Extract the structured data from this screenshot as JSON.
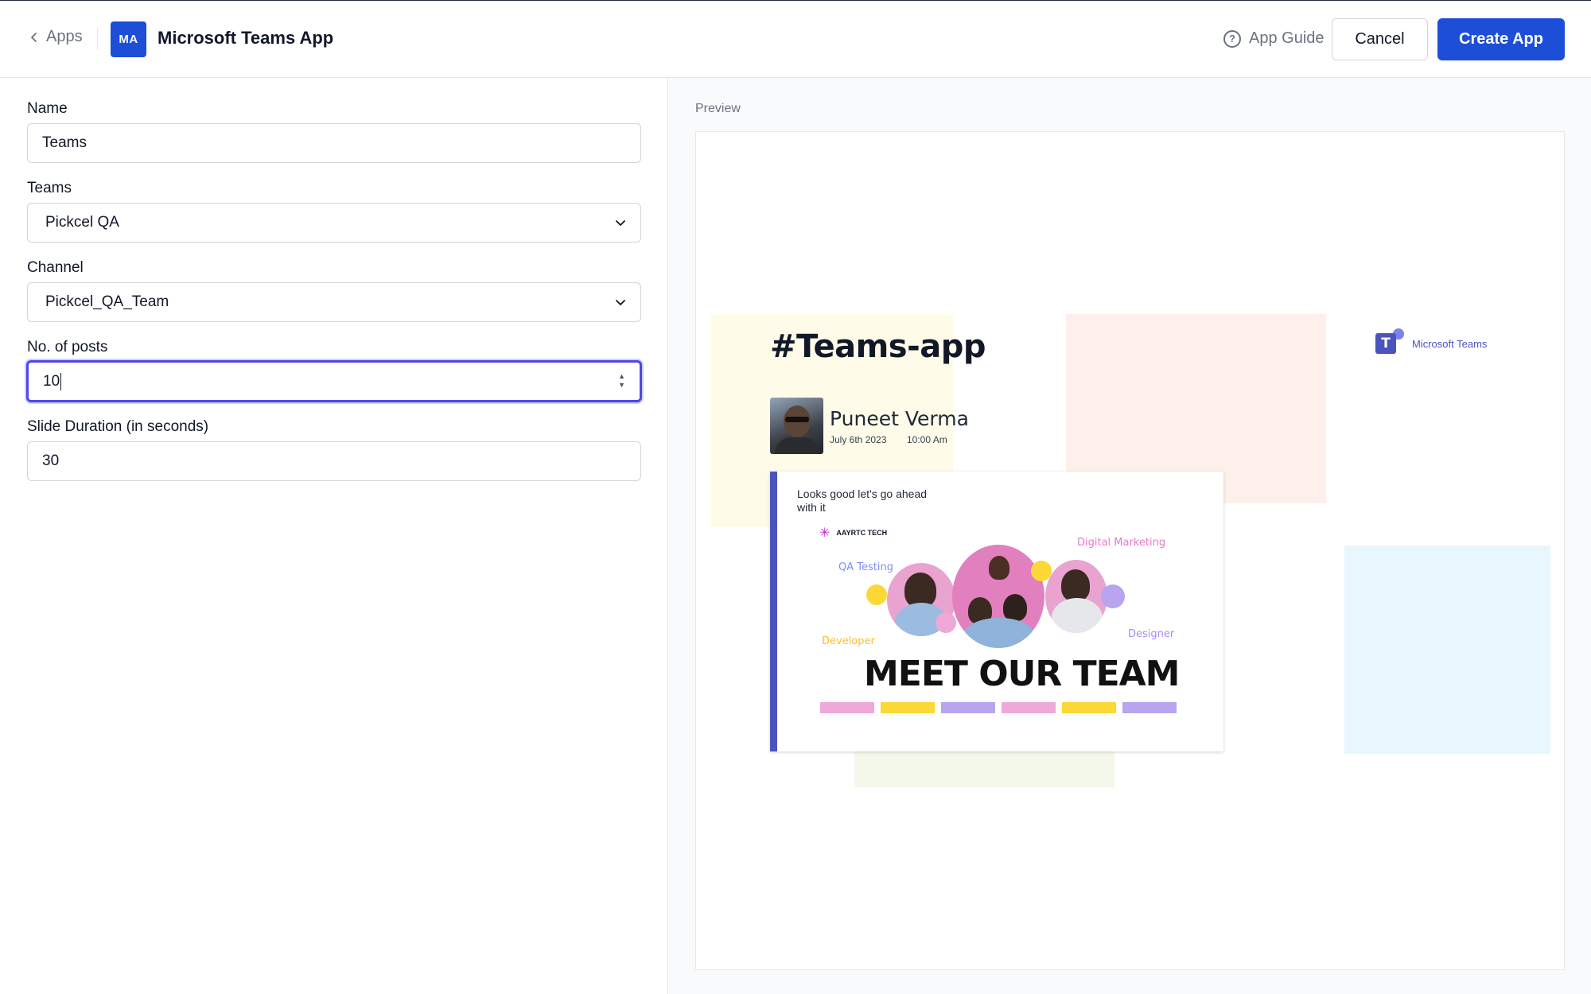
{
  "header": {
    "back_label": "Apps",
    "avatar_initials": "MA",
    "title": "Microsoft Teams App",
    "guide_label": "App Guide",
    "cancel_label": "Cancel",
    "create_label": "Create App"
  },
  "form": {
    "name": {
      "label": "Name",
      "value": "Teams"
    },
    "teams": {
      "label": "Teams",
      "value": "Pickcel QA"
    },
    "channel": {
      "label": "Channel",
      "value": "Pickcel_QA_Team"
    },
    "posts": {
      "label": "No. of posts",
      "value": "10"
    },
    "duration": {
      "label": "Slide Duration (in seconds)",
      "value": "30"
    }
  },
  "preview": {
    "label": "Preview",
    "hashtag": "#Teams-app",
    "user_name": "Puneet Verma",
    "post_date": "July 6th 2023",
    "post_time": "10:00 Am",
    "teams_logo_text": "Microsoft Teams",
    "post_text": "Looks good let's go ahead with it",
    "brand": "AAYRTC TECH",
    "roles": {
      "qa": "QA Testing",
      "digital": "Digital Marketing",
      "developer": "Developer",
      "designer": "Designer"
    },
    "headline": "MEET OUR TEAM"
  },
  "colors": {
    "primary": "#1d4ed8",
    "focus": "#4f46e5",
    "teams_purple": "#4b53bc",
    "pink": "#f0a8d8",
    "yellow": "#fcd836",
    "lavender": "#b8a4ef"
  },
  "icons": {
    "back": "chevron-left-icon",
    "guide": "question-circle-icon",
    "select": "chevron-down-icon",
    "spinner": "spinner-arrows-icon"
  }
}
